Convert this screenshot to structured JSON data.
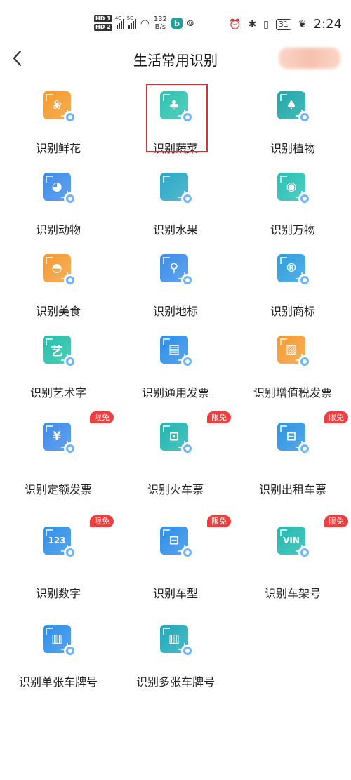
{
  "status_bar": {
    "hd1": "HD 1",
    "hd2": "HD 2",
    "net1": "4G",
    "net2": "5G",
    "speed_value": "132",
    "speed_unit": "B/s",
    "app_letter": "b",
    "battery": "31",
    "time": "2:24"
  },
  "header": {
    "title": "生活常用识别"
  },
  "items": [
    {
      "label": "识别鲜花",
      "badge": "",
      "color": "#f39a2b",
      "cam": "#6bb4ff",
      "glyph": "❀"
    },
    {
      "label": "识别蔬菜",
      "badge": "",
      "color": "#2ec2b0",
      "cam": "#6bb4ff",
      "glyph": "♣"
    },
    {
      "label": "识别植物",
      "badge": "",
      "color": "#1ea7a8",
      "cam": "#6bb4ff",
      "glyph": "♠"
    },
    {
      "label": "识别动物",
      "badge": "",
      "color": "#3d8be9",
      "cam": "#6bb4ff",
      "glyph": "◕"
    },
    {
      "label": "识别水果",
      "badge": "",
      "color": "#2aa8c6",
      "cam": "#6bb4ff",
      "glyph": ""
    },
    {
      "label": "识别万物",
      "badge": "",
      "color": "#27c1b4",
      "cam": "#6bb4ff",
      "glyph": "◉"
    },
    {
      "label": "识别美食",
      "badge": "",
      "color": "#f49b32",
      "cam": "#6bb4ff",
      "glyph": "◓"
    },
    {
      "label": "识别地标",
      "badge": "",
      "color": "#3b8de8",
      "cam": "#6bb4ff",
      "glyph": "⚲"
    },
    {
      "label": "识别商标",
      "badge": "",
      "color": "#2c9ee0",
      "cam": "#6bb4ff",
      "glyph": "®"
    },
    {
      "label": "识别艺术字",
      "badge": "",
      "color": "#25bfa9",
      "cam": "#6bb4ff",
      "glyph": "艺"
    },
    {
      "label": "识别通用发票",
      "badge": "",
      "color": "#2d8ee8",
      "cam": "#6bb4ff",
      "glyph": "▤"
    },
    {
      "label": "识别增值税发票",
      "badge": "",
      "color": "#f49b32",
      "cam": "#6bb4ff",
      "glyph": "▨"
    },
    {
      "label": "识别定额发票",
      "badge": "限免",
      "color": "#3d8be9",
      "cam": "#6bb4ff",
      "glyph": "¥"
    },
    {
      "label": "识别火车票",
      "badge": "限免",
      "color": "#1fb5b0",
      "cam": "#6bb4ff",
      "glyph": "⊡"
    },
    {
      "label": "识别出租车票",
      "badge": "限免",
      "color": "#2c93e3",
      "cam": "#6bb4ff",
      "glyph": "⊟"
    },
    {
      "label": "识别数字",
      "badge": "限免",
      "color": "#2f8fe6",
      "cam": "#6bb4ff",
      "glyph": "123"
    },
    {
      "label": "识别车型",
      "badge": "限免",
      "color": "#2d8ee8",
      "cam": "#6bb4ff",
      "glyph": "⊟"
    },
    {
      "label": "识别车架号",
      "badge": "限免",
      "color": "#21b9b0",
      "cam": "#6bb4ff",
      "glyph": "VIN"
    },
    {
      "label": "识别单张车牌号",
      "badge": "",
      "color": "#2d8ee8",
      "cam": "#6bb4ff",
      "glyph": "▥"
    },
    {
      "label": "识别多张车牌号",
      "badge": "",
      "color": "#1fa9b8",
      "cam": "#6bb4ff",
      "glyph": "▥"
    }
  ]
}
